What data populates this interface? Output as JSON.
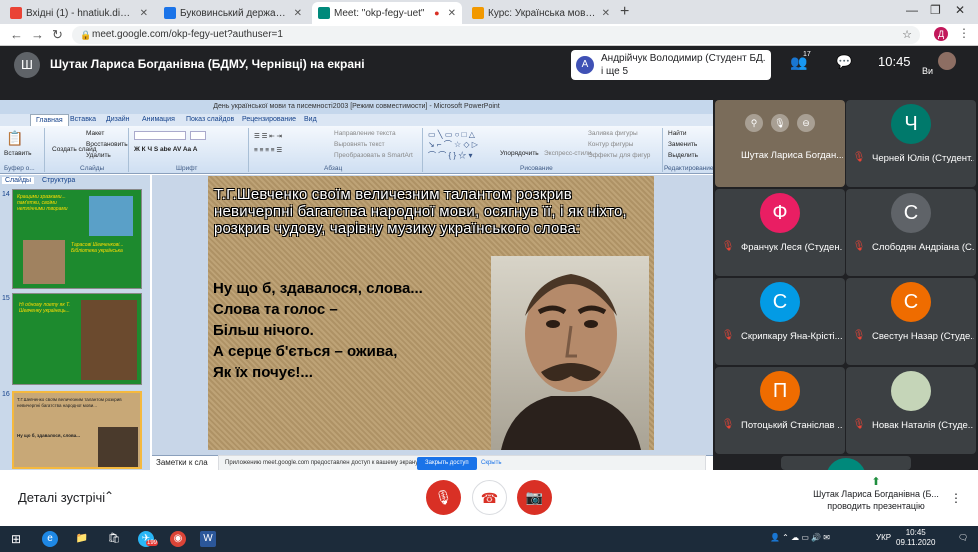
{
  "browser": {
    "tabs": [
      {
        "title": "Вхідні (1) - hnatiuk.diana.st@bsm",
        "favicon_color": "#ea4335",
        "active": false
      },
      {
        "title": "Буковинський державний медич",
        "favicon_color": "#1a73e8",
        "active": false
      },
      {
        "title": "Meet: \"okp-fegy-uet\"",
        "favicon_color": "#00897b",
        "active": true
      },
      {
        "title": "Курс: Українська мова (за проф",
        "favicon_color": "#f29900",
        "active": false
      }
    ],
    "url": "meet.google.com/okp-fegy-uet?authuser=1",
    "profile_letter": "Д"
  },
  "meet": {
    "presenter_initial": "Ш",
    "presenter_title": "Шутак Лариса Богданівна (БДМУ, Чернівці) на екрані",
    "speaker_initial": "А",
    "speaker_line1": "Андрійчук Володимир (Студент БД...",
    "speaker_line2": "і ще 5",
    "people_count": "17",
    "time": "10:45",
    "self_label": "Ви"
  },
  "ppt": {
    "window_title": "День української мови та писемності2003 [Режим совместимости] - Microsoft PowerPoint",
    "tabs": [
      "Главная",
      "Вставка",
      "Дизайн",
      "Анимация",
      "Показ слайдов",
      "Рецензирование",
      "Вид"
    ],
    "groups": [
      "Буфер о...",
      "Слайды",
      "Шрифт",
      "Абзац",
      "Рисование",
      "Редактирование"
    ],
    "buttons": {
      "paste": "Вставить",
      "create": "Создать слайд",
      "layout": "Макет",
      "restore": "Восстановить",
      "delete": "Удалить",
      "text_dir": "Направление текста",
      "align_text": "Выровнять текст",
      "smartart": "Преобразовать в SmartArt",
      "arrange": "Упорядочить",
      "quick_styles": "Экспресс-стили",
      "fill": "Заливка фигуры",
      "outline": "Контур фигуры",
      "effects": "Эффекты для фигур",
      "find": "Найти",
      "replace": "Заменить",
      "select": "Выделить"
    },
    "pane_tabs": [
      "Слайды",
      "Структура"
    ],
    "thumb_numbers": [
      "14",
      "15",
      "16"
    ],
    "thumb14_text": "Кращими зразками... пам'ятки, своїми нетлінними творами",
    "thumb14_caption": "Тарасові Шевченкові... Бібліотека українська",
    "thumb15_text": "Ні одному поету як Т. Шевченку українець...",
    "thumb16_text": "Т.Г.Шевченко своїм величезним талантом розкрив невичерпні багатства народної мови...",
    "slide_paragraph": "Т.Г.Шевченко своїм величезним талантом розкрив невичерпні багатства народної мови, осягнув її, і як ніхто, розкрив чудову, чарівну музику українського слова:",
    "poem": [
      "Ну що б, здавалося, слова...",
      "Слова та голос –",
      "Більш нічого.",
      "А серце б'ється – ожива,",
      "Як їх почує!..."
    ],
    "notes_placeholder": "Заметки к сла",
    "share_message": "Приложению meet.google.com предоставлен доступ к вашему экрану.",
    "share_stop": "Закрыть доступ",
    "share_hide": "Скрыть"
  },
  "participants": [
    {
      "name": "Шутак Лариса Богдан...",
      "initial": "",
      "color": "#7a6c5a",
      "video": true
    },
    {
      "name": "Черней Юлія (Студент...",
      "initial": "Ч",
      "color": "#00796b",
      "video": false
    },
    {
      "name": "Франчук Леся (Студен...",
      "initial": "Ф",
      "color": "#e91e63",
      "video": false
    },
    {
      "name": "Слободян Андріана (С...",
      "initial": "С",
      "color": "#5f6368",
      "video": false
    },
    {
      "name": "Скрипкару Яна-Крісті...",
      "initial": "С",
      "color": "#039be5",
      "video": false
    },
    {
      "name": "Свестун Назар (Студе...",
      "initial": "С",
      "color": "#ef6c00",
      "video": false
    },
    {
      "name": "Потоцький Станіслав ...",
      "initial": "П",
      "color": "#ef6c00",
      "video": false
    },
    {
      "name": "Новак Наталія (Студе...",
      "initial": "",
      "color": "#c5d5b8",
      "video": false
    },
    {
      "name": "",
      "initial": "",
      "color": "#00897b",
      "video": false
    }
  ],
  "bottom": {
    "details": "Деталі зустрічі",
    "present_line1": "Шутак Лариса Богданівна (Б...",
    "present_line2": "проводить презентацію"
  },
  "taskbar": {
    "lang": "УКР",
    "time": "10:45",
    "date": "09.11.2020",
    "badge": "199"
  }
}
